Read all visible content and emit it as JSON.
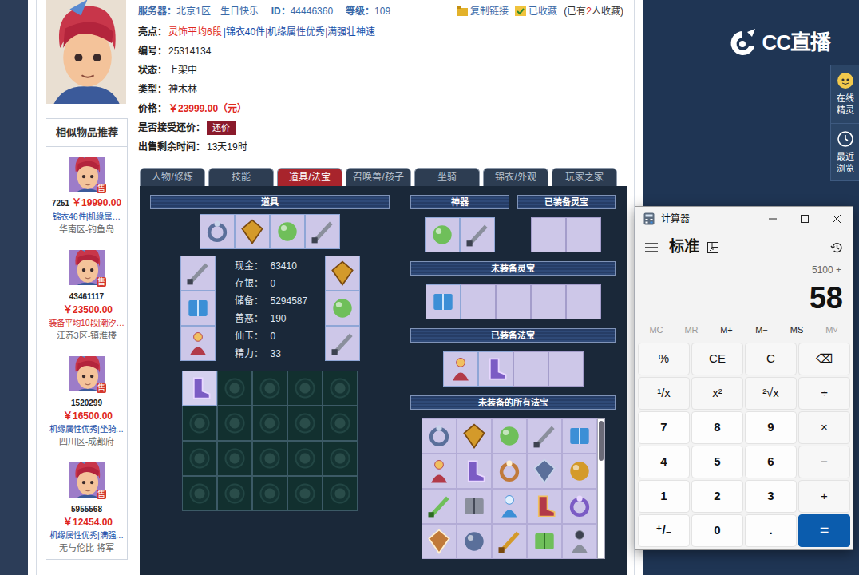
{
  "listing": {
    "server": {
      "label": "服务器：",
      "value": "北京1区一生日快乐"
    },
    "id": {
      "label": "ID：",
      "value": "44446360"
    },
    "level": {
      "label": "等级：",
      "value": "109"
    },
    "actions": [
      {
        "label": "复制链接"
      },
      {
        "label": "已收藏"
      }
    ],
    "favorites": [
      {
        "text": "(已有",
        "highlight": false
      },
      {
        "text": "2",
        "highlight": true
      },
      {
        "text": "人收藏)",
        "highlight": false
      }
    ],
    "fields": [
      {
        "label": "亮点：",
        "kind": "tags",
        "segments": [
          {
            "text": "灵饰平均6段",
            "highlight": true
          },
          {
            "text": "|锦衣40件|机缘属性优秀|满强壮神速",
            "highlight": false
          }
        ]
      },
      {
        "label": "编号：",
        "kind": "text",
        "value": "25314134"
      },
      {
        "label": "状态：",
        "kind": "text",
        "value": "上架中"
      },
      {
        "label": "类型：",
        "kind": "text",
        "value": "神木林"
      },
      {
        "label": "价格：",
        "kind": "price",
        "value": "￥23999.00（元）"
      },
      {
        "label": "是否接受还价：",
        "kind": "button",
        "value": "还价"
      },
      {
        "label": "出售剩余时间：",
        "kind": "text",
        "value": "13天19时"
      }
    ]
  },
  "similar": {
    "title": "相似物品推荐",
    "items": [
      {
        "id": "7251",
        "price": "￥19990.00",
        "tag": "锦衣46件|机缘属…",
        "highlight": false,
        "server": "华南区-钓鱼岛",
        "badge": "售"
      },
      {
        "id": "43461117",
        "price": "￥23500.00",
        "tag": "装备平均10段|潮汐…",
        "highlight": true,
        "server": "江苏3区-镇淮楼",
        "badge": "售"
      },
      {
        "id": "1520299",
        "price": "￥16500.00",
        "tag": "机缘属性优秀|坐骑…",
        "highlight": false,
        "server": "四川区-成都府",
        "badge": "售"
      },
      {
        "id": "5955568",
        "price": "￥12454.00",
        "tag": "机缘属性优秀|满强…",
        "highlight": false,
        "server": "无与伦比-将军",
        "badge": "售"
      }
    ]
  },
  "tabs": [
    {
      "label": "人物/修炼",
      "selected": false
    },
    {
      "label": "技能",
      "selected": false
    },
    {
      "label": "道具/法宝",
      "selected": true
    },
    {
      "label": "召唤兽/孩子",
      "selected": false
    },
    {
      "label": "坐骑",
      "selected": false
    },
    {
      "label": "锦衣/外观",
      "selected": false
    },
    {
      "label": "玩家之家",
      "selected": false
    }
  ],
  "panel": {
    "inventory": {
      "title": "道具",
      "top": [
        {
          "filled": true
        },
        {
          "filled": true
        },
        {
          "filled": true
        },
        {
          "filled": true
        }
      ],
      "left_equip": [
        {
          "filled": true
        },
        {
          "filled": true
        },
        {
          "filled": true
        }
      ],
      "right_equip": [
        {
          "filled": true
        },
        {
          "filled": true
        },
        {
          "filled": true
        }
      ],
      "stats": [
        {
          "label": "现金：",
          "value": "63410"
        },
        {
          "label": "存银：",
          "value": "0"
        },
        {
          "label": "储备：",
          "value": "5294587"
        },
        {
          "label": "善恶：",
          "value": "190"
        },
        {
          "label": "仙玉：",
          "value": "0"
        },
        {
          "label": "精力：",
          "value": "33"
        }
      ],
      "bag": [
        {
          "filled": true
        },
        {
          "filled": false
        },
        {
          "filled": false
        },
        {
          "filled": false
        },
        {
          "filled": false
        },
        {
          "filled": false
        },
        {
          "filled": false
        },
        {
          "filled": false
        },
        {
          "filled": false
        },
        {
          "filled": false
        },
        {
          "filled": false
        },
        {
          "filled": false
        },
        {
          "filled": false
        },
        {
          "filled": false
        },
        {
          "filled": false
        },
        {
          "filled": false
        },
        {
          "filled": false
        },
        {
          "filled": false
        },
        {
          "filled": false
        },
        {
          "filled": false
        }
      ]
    },
    "artifacts": {
      "title": "神器",
      "slots": [
        {
          "filled": true
        },
        {
          "filled": true
        }
      ]
    },
    "equipped_lingbao": {
      "title": "已装备灵宝",
      "slots": [
        {
          "filled": false
        },
        {
          "filled": false
        }
      ]
    },
    "unequipped_lingbao": {
      "title": "未装备灵宝",
      "slots": [
        {
          "filled": true
        },
        {
          "filled": false
        },
        {
          "filled": false
        },
        {
          "filled": false
        },
        {
          "filled": false
        }
      ]
    },
    "equipped_fabao": {
      "title": "已装备法宝",
      "slots": [
        {
          "filled": true
        },
        {
          "filled": true
        },
        {
          "filled": false
        },
        {
          "filled": false
        }
      ]
    },
    "all_fabao": {
      "title": "未装备的所有法宝",
      "scroll_position": 0,
      "slots": [
        {
          "filled": true
        },
        {
          "filled": true
        },
        {
          "filled": true
        },
        {
          "filled": true
        },
        {
          "filled": true
        },
        {
          "filled": true
        },
        {
          "filled": true
        },
        {
          "filled": true
        },
        {
          "filled": true
        },
        {
          "filled": true
        },
        {
          "filled": true
        },
        {
          "filled": true
        },
        {
          "filled": true
        },
        {
          "filled": true
        },
        {
          "filled": true
        },
        {
          "filled": true
        },
        {
          "filled": true
        },
        {
          "filled": true
        },
        {
          "filled": true
        },
        {
          "filled": true
        }
      ]
    }
  },
  "site": {
    "logo": "CC直播",
    "tools": [
      {
        "label": "在线精灵"
      },
      {
        "label": "最近浏览"
      }
    ]
  },
  "calculator": {
    "title": "计算器",
    "mode": "标准",
    "expression": "5100 +",
    "display": "58",
    "memory": [
      {
        "label": "MC",
        "disabled": true
      },
      {
        "label": "MR",
        "disabled": true
      },
      {
        "label": "M+",
        "disabled": false
      },
      {
        "label": "M−",
        "disabled": false
      },
      {
        "label": "MS",
        "disabled": false
      },
      {
        "label": "M˅",
        "disabled": true
      }
    ],
    "keys": [
      {
        "label": "%",
        "kind": "fn"
      },
      {
        "label": "CE",
        "kind": "fn"
      },
      {
        "label": "C",
        "kind": "fn"
      },
      {
        "label": "⌫",
        "kind": "fn"
      },
      {
        "label": "¹/x",
        "kind": "fn"
      },
      {
        "label": "x²",
        "kind": "fn"
      },
      {
        "label": "²√x",
        "kind": "fn"
      },
      {
        "label": "÷",
        "kind": "fn"
      },
      {
        "label": "7",
        "kind": "num"
      },
      {
        "label": "8",
        "kind": "num"
      },
      {
        "label": "9",
        "kind": "num"
      },
      {
        "label": "×",
        "kind": "fn"
      },
      {
        "label": "4",
        "kind": "num"
      },
      {
        "label": "5",
        "kind": "num"
      },
      {
        "label": "6",
        "kind": "num"
      },
      {
        "label": "−",
        "kind": "fn"
      },
      {
        "label": "1",
        "kind": "num"
      },
      {
        "label": "2",
        "kind": "num"
      },
      {
        "label": "3",
        "kind": "num"
      },
      {
        "label": "+",
        "kind": "fn"
      },
      {
        "label": "⁺/₋",
        "kind": "num"
      },
      {
        "label": "0",
        "kind": "num"
      },
      {
        "label": ".",
        "kind": "num"
      },
      {
        "label": "=",
        "kind": "eq"
      }
    ]
  }
}
